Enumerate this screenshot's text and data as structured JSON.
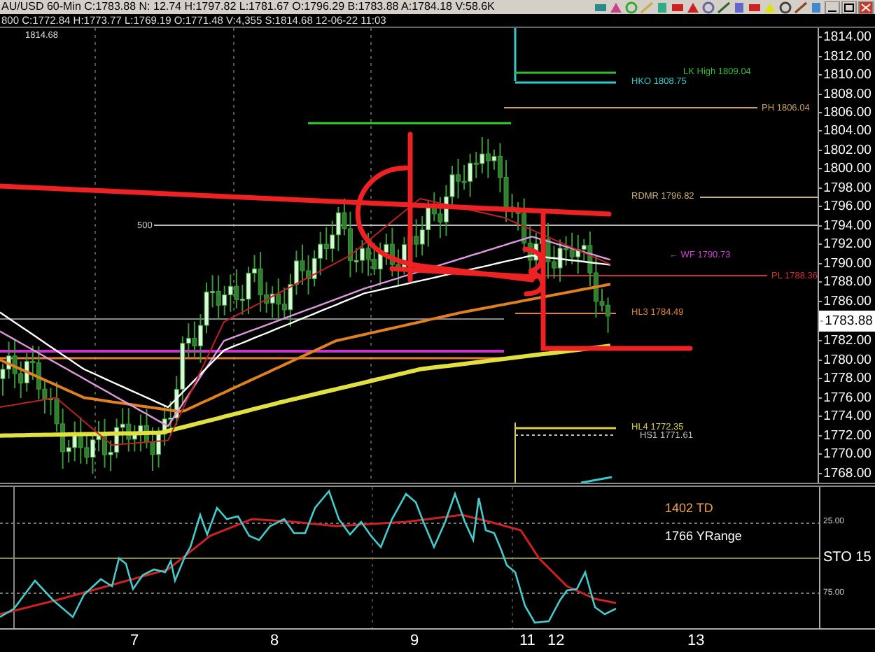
{
  "quote_bar": {
    "text": "AU/USD 60-Min C:1783.88 N: 12.74 H:1797.82 L:1781.67 O:1796.29 B:1783.88 A:1784.18 V:58.6K"
  },
  "info_line": {
    "text": "800 C:1772.84 H:1773.77 L:1769.19 O:1771.48 V:4,355 S:1814.68 12-06-22 11:03"
  },
  "chart": {
    "top_label": "1814.68",
    "line_label": "500",
    "levels": [
      {
        "label": "LK High 1809.04",
        "color": "#33bb33"
      },
      {
        "label": "HKO 1808.75",
        "color": "#33cccc"
      },
      {
        "label": "PH 1806.04",
        "color": "#c8a060"
      },
      {
        "label": "RDMR 1796.82",
        "color": "#c8b070"
      },
      {
        "label": "← WF 1790.73",
        "color": "#cc44cc"
      },
      {
        "label": "PL 1788.36",
        "color": "#cc3333"
      },
      {
        "label": "HL3 1784.49",
        "color": "#e08030"
      },
      {
        "label": "HL4 1772.35",
        "color": "#d8d040"
      },
      {
        "label": "HS1 1771.61",
        "color": "#c0c0c0"
      }
    ]
  },
  "price_axis": [
    {
      "text": "1814.00",
      "current": false
    },
    {
      "text": "1812.00",
      "current": false
    },
    {
      "text": "1810.00",
      "current": false
    },
    {
      "text": "1808.00",
      "current": false
    },
    {
      "text": "1806.00",
      "current": false
    },
    {
      "text": "1804.00",
      "current": false
    },
    {
      "text": "1802.00",
      "current": false
    },
    {
      "text": "1800.00",
      "current": false
    },
    {
      "text": "1798.00",
      "current": false
    },
    {
      "text": "1796.00",
      "current": false
    },
    {
      "text": "1794.00",
      "current": false
    },
    {
      "text": "1792.00",
      "current": false
    },
    {
      "text": "1790.00",
      "current": false
    },
    {
      "text": "1788.00",
      "current": false
    },
    {
      "text": "1786.00",
      "current": false
    },
    {
      "text": "1783.88",
      "current": true
    },
    {
      "text": "1782.00",
      "current": false
    },
    {
      "text": "1780.00",
      "current": false
    },
    {
      "text": "1778.00",
      "current": false
    },
    {
      "text": "1776.00",
      "current": false
    },
    {
      "text": "1774.00",
      "current": false
    },
    {
      "text": "1772.00",
      "current": false
    },
    {
      "text": "1770.00",
      "current": false
    },
    {
      "text": "1768.00",
      "current": false
    }
  ],
  "oscillator": {
    "labels": [
      {
        "text": "1402 TD",
        "color": "#f0a050"
      },
      {
        "text": "1766 YRange",
        "color": "#ffffff"
      }
    ],
    "axis": [
      "25.00",
      "STO  15",
      "75.00"
    ]
  },
  "time_axis": [
    "7",
    "8",
    "9",
    "11",
    "12",
    "13"
  ]
}
